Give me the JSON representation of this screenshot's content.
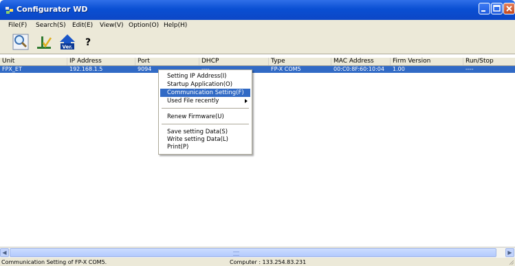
{
  "window": {
    "title": "Configurator WD"
  },
  "menu": [
    {
      "label": "File(F)"
    },
    {
      "label": "Search(S)"
    },
    {
      "label": "Edit(E)"
    },
    {
      "label": "View(V)"
    },
    {
      "label": "Option(O)"
    },
    {
      "label": "Help(H)"
    }
  ],
  "toolbar": {
    "buttons": [
      {
        "icon": "search-magnifier-icon"
      },
      {
        "icon": "check-edit-icon"
      },
      {
        "icon": "version-up-arrow-icon",
        "label": "Ver."
      },
      {
        "icon": "help-question-icon",
        "label": "?"
      }
    ]
  },
  "table": {
    "columns": [
      "Unit",
      "IP Address",
      "Port",
      "DHCP",
      "Type",
      "MAC Address",
      "Firm Version",
      "Run/Stop"
    ],
    "rows": [
      {
        "unit": "FPX_ET",
        "ip": "192.168.1.5",
        "port": "9094",
        "dhcp": "----",
        "type": "FP-X COM5",
        "mac": "00:C0:8F:60:10:04",
        "firm": "1.00",
        "runstop": "----"
      }
    ]
  },
  "context_menu": {
    "items": [
      {
        "label": "Setting IP Address(I)"
      },
      {
        "label": "Startup Application(O)"
      },
      {
        "label": "Communication Setting(F)",
        "selected": true
      },
      {
        "label": "Used File recently",
        "submenu": true
      },
      {
        "label": "Renew Firmware(U)"
      },
      {
        "label": "Save setting Data(S)"
      },
      {
        "label": "Write setting Data(L)"
      },
      {
        "label": "Print(P)"
      }
    ]
  },
  "status": {
    "left": "Communication Setting of FP-X COM5.",
    "center": "Computer : 133.254.83.231"
  },
  "colors": {
    "titlebar": "#0a4fd3",
    "selection": "#316ac5",
    "chrome": "#ece9d8"
  }
}
